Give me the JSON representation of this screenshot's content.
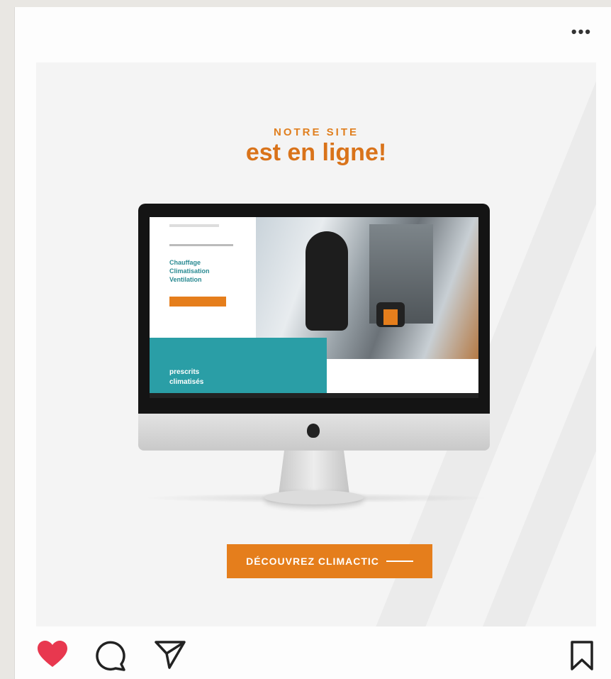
{
  "post": {
    "kicker": "NOTRE SITE",
    "headline": "est en ligne!",
    "cta_label": "DÉCOUVREZ CLIMACTIC",
    "colors": {
      "accent": "#e57e1c",
      "teal": "#2a9ea6",
      "like": "#e8384f"
    }
  },
  "screen": {
    "hero_lines": [
      "Chauffage",
      "Climatisation",
      "Ventilation"
    ],
    "panel_lines": [
      "prescrits",
      "climatisés"
    ]
  },
  "actions": {
    "icons": [
      "heart-icon",
      "comment-icon",
      "share-icon",
      "bookmark-icon"
    ],
    "liked": true
  }
}
